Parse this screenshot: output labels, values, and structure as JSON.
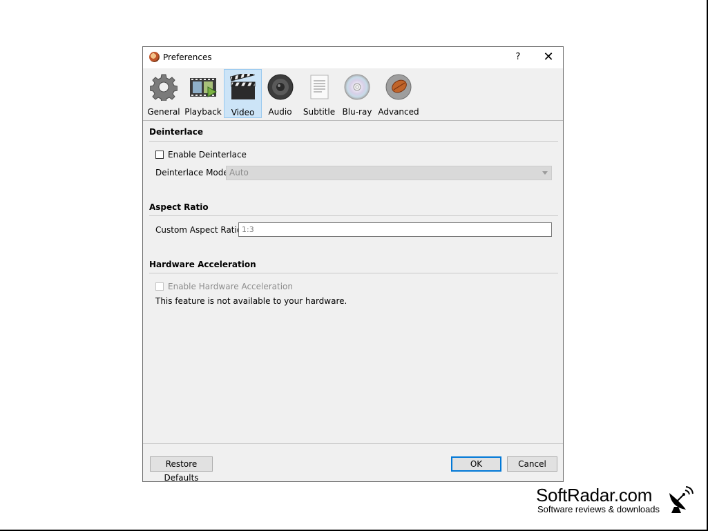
{
  "window": {
    "title": "Preferences",
    "help_label": "?",
    "close_label": "✕"
  },
  "tabs": [
    {
      "label": "General",
      "icon": "gear-icon"
    },
    {
      "label": "Playback",
      "icon": "film-strip-icon"
    },
    {
      "label": "Video",
      "icon": "clapperboard-icon",
      "active": true
    },
    {
      "label": "Audio",
      "icon": "speaker-icon"
    },
    {
      "label": "Subtitle",
      "icon": "document-icon"
    },
    {
      "label": "Blu-ray",
      "icon": "disc-icon"
    },
    {
      "label": "Advanced",
      "icon": "advanced-icon"
    }
  ],
  "deinterlace": {
    "title": "Deinterlace",
    "enable_label": "Enable Deinterlace",
    "enabled": false,
    "mode_label": "Deinterlace Mode:",
    "mode_value": "Auto"
  },
  "aspect": {
    "title": "Aspect Ratio",
    "custom_label": "Custom Aspect Ratio:",
    "custom_placeholder": "1:3"
  },
  "hardware": {
    "title": "Hardware Acceleration",
    "enable_label": "Enable Hardware Acceleration",
    "enabled": false,
    "note": "This feature is not available to your hardware."
  },
  "footer": {
    "restore_label": "Restore Defaults",
    "ok_label": "OK",
    "cancel_label": "Cancel"
  },
  "watermark": {
    "title": "SoftRadar.com",
    "subtitle": "Software reviews & downloads",
    "icon": "satellite-dish-icon"
  },
  "colors": {
    "active_tab_bg": "#cce4f7",
    "active_tab_border": "#99c9ef",
    "primary_button_border": "#0078d7"
  }
}
